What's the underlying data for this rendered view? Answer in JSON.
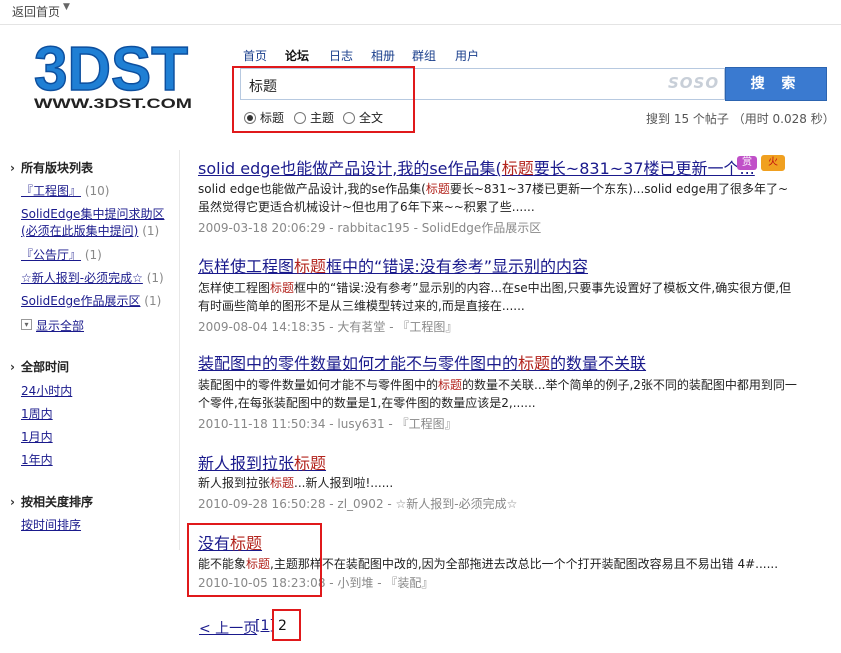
{
  "topbar": {
    "back_label": "返回首页"
  },
  "logo": {
    "main": "3DST",
    "sub": "WWW.3DST.COM"
  },
  "nav": [
    "首页",
    "论坛",
    "日志",
    "相册",
    "群组",
    "用户"
  ],
  "search": {
    "value": "标题",
    "button_label": "搜 索",
    "watermark": "SOSO",
    "scopes": [
      {
        "label": "标题",
        "selected": true
      },
      {
        "label": "主题",
        "selected": false
      },
      {
        "label": "全文",
        "selected": false
      }
    ],
    "result_count": "搜到 15 个帖子 （用时 0.028 秒）"
  },
  "sidebar": {
    "forums_heading": "所有版块列表",
    "forums": [
      {
        "name": "『工程图』",
        "count": "(10)"
      },
      {
        "name": "SolidEdge集中提问求助区",
        "name2": "(必须在此版集中提问)",
        "count": "(1)"
      },
      {
        "name": "『公告厅』",
        "count": "(1)"
      },
      {
        "name": "☆新人报到-必须完成☆",
        "count": "(1)"
      },
      {
        "name": "SolidEdge作品展示区",
        "count": "(1)"
      }
    ],
    "expand_label": "显示全部",
    "time_heading": "全部时间",
    "times": [
      "24小时内",
      "1周内",
      "1月内",
      "1年内"
    ],
    "sort_heading": "按相关度排序",
    "sort_option": "按时间排序"
  },
  "results": [
    {
      "title_pre": "solid edge也能做产品设计,我的se作品集(",
      "title_hl": "标题",
      "title_post": "要长~831~37楼已更新一个...",
      "body_pre": "solid edge也能做产品设计,我的se作品集(",
      "body_hl": "标题",
      "body_post": "要长~831~37楼已更新一个东东)...solid edge用了很多年了~虽然觉得它更适合机械设计~但也用了6年下来~~积累了些......",
      "meta": "2009-03-18 20:06:29 - rabbitac195 - SolidEdge作品展示区",
      "badge1": "赏",
      "badge2": "火"
    },
    {
      "title_pre": "怎样使工程图",
      "title_hl": "标题",
      "title_post": "框中的“错误:没有参考”显示别的内容",
      "body_pre": "怎样使工程图",
      "body_hl": "标题",
      "body_post": "框中的“错误:没有参考”显示别的内容...在se中出图,只要事先设置好了模板文件,确实很方便,但有时画些简单的图形不是从三维模型转过来的,而是直接在......",
      "meta": "2009-08-04 14:18:35 - 大有茗堂 - 『工程图』"
    },
    {
      "title_pre": "装配图中的零件数量如何才能不与零件图中的",
      "title_hl": "标题",
      "title_post": "的数量不关联",
      "body_pre": "装配图中的零件数量如何才能不与零件图中的",
      "body_hl": "标题",
      "body_post": "的数量不关联...举个简单的例子,2张不同的装配图中都用到同一个零件,在每张装配图中的数量是1,在零件图的数量应该是2,......",
      "meta": "2010-11-18 11:50:34 - lusy631 - 『工程图』"
    },
    {
      "title_pre": "新人报到拉张",
      "title_hl": "标题",
      "title_post": "",
      "body_pre": "新人报到拉张",
      "body_hl": "标题",
      "body_post": "...新人报到啦!......",
      "meta": "2010-09-28 16:50:28 - zl_0902 - ☆新人报到-必须完成☆"
    },
    {
      "title_pre": "没有",
      "title_hl": "标题",
      "title_post": "",
      "body_pre": "能不能象",
      "body_hl": "标题",
      "body_post": ",主题那样不在装配图中改的,因为全部拖进去改总比一个个打开装配图改容易且不易出错 4#......",
      "meta": "2010-10-05 18:23:08 - 小到堆 - 『装配』"
    }
  ],
  "pagination": {
    "prev": "< 上一页",
    "page1": "[1]",
    "current": "2"
  },
  "colors": {
    "highlight": "#b3241d",
    "link": "#1a1a8c",
    "search_button": "#3a7ad0",
    "annotation_box": "#e0191b"
  }
}
